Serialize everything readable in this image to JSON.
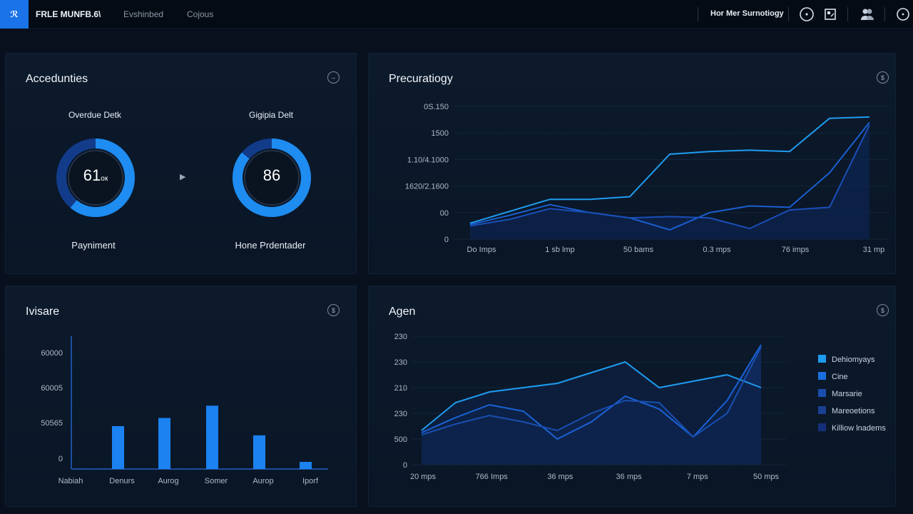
{
  "topbar": {
    "logo": "ℛ",
    "app_title": "FRLE MUNFB.6\\",
    "nav": [
      "Evshinbed",
      "Cojous"
    ],
    "user": "Hor Mer Surnotiogy",
    "icons": [
      "clock-icon",
      "calendar-icon",
      "users-icon",
      "power-icon"
    ]
  },
  "accent": "#1a73e8",
  "panels": {
    "accedunties": {
      "title": "Accedunties",
      "gauges": [
        {
          "label": "Overdue Detk",
          "value": "61",
          "unit": "ок",
          "caption": "Payniment",
          "fraction": 0.61
        },
        {
          "label": "Gigipia Delt",
          "value": "86",
          "unit": "",
          "caption": "Hone Prdentader",
          "fraction": 0.86
        }
      ]
    },
    "precuratiogy": {
      "title": "Precuratiogy"
    },
    "ivisare": {
      "title": "Ivisare"
    },
    "agen": {
      "title": "Agen",
      "legend": [
        "Dehiomyays",
        "Cine",
        "Marsarie",
        "Mareoetions",
        "Killiow lnadems"
      ]
    }
  },
  "chart_data": [
    {
      "type": "line",
      "title": "Precuratiogy",
      "y_tick_labels": [
        "0",
        "00",
        "1620/2.1600",
        "1.10/4.1000",
        "1500",
        "0S.150"
      ],
      "x_tick_labels": [
        "Do Imps",
        "1 sb lmp",
        "50 bams",
        "0.3 mps",
        "76 imps",
        "31 mp"
      ],
      "x": [
        0,
        0.5,
        1,
        1.5,
        2,
        2.5,
        3,
        3.5,
        4,
        4.5,
        5
      ],
      "ylim": [
        0,
        5
      ],
      "series": [
        {
          "values": [
            0.6,
            1.05,
            1.5,
            1.5,
            1.6,
            3.2,
            3.3,
            3.35,
            3.3,
            4.55,
            4.6
          ]
        },
        {
          "values": [
            0.55,
            0.9,
            1.3,
            1.0,
            0.8,
            0.35,
            1.0,
            1.25,
            1.2,
            2.5,
            4.4
          ]
        },
        {
          "values": [
            0.5,
            0.75,
            1.15,
            1.0,
            0.8,
            0.85,
            0.8,
            0.4,
            1.1,
            1.2,
            4.3
          ]
        }
      ]
    },
    {
      "type": "bar",
      "title": "Ivisare",
      "y_tick_labels": [
        "0",
        "50565",
        "60005",
        "60000"
      ],
      "categories": [
        "Nabiah",
        "Denurs",
        "Aurog",
        "Somer",
        "Aurop",
        "Iporf"
      ],
      "values": [
        0,
        42,
        50,
        62,
        33,
        7
      ],
      "ylim": [
        0,
        130
      ]
    },
    {
      "type": "area",
      "title": "Agen",
      "y_tick_labels": [
        "0",
        "500",
        "230",
        "210",
        "230",
        "230"
      ],
      "x_tick_labels": [
        "20 mps",
        "766 Imps",
        "36 mps",
        "36 mps",
        "7 mps",
        "50 mps"
      ],
      "x": [
        0,
        0.5,
        1,
        1.5,
        2,
        2.5,
        3,
        3.5,
        4,
        4.5,
        5
      ],
      "ylim": [
        0,
        6
      ],
      "series": [
        {
          "name": "Dehiomyays",
          "values": [
            1.6,
            2.9,
            3.4,
            3.6,
            3.8,
            4.3,
            4.8,
            3.6,
            3.9,
            4.2,
            3.6
          ]
        },
        {
          "name": "Cine",
          "values": [
            1.5,
            2.2,
            2.8,
            2.5,
            1.2,
            2.0,
            3.2,
            2.6,
            1.3,
            3.0,
            5.6
          ]
        },
        {
          "name": "Marsarie",
          "values": [
            1.4,
            1.9,
            2.3,
            2.0,
            1.6,
            2.4,
            3.0,
            2.9,
            1.3,
            2.4,
            5.5
          ]
        }
      ]
    }
  ]
}
